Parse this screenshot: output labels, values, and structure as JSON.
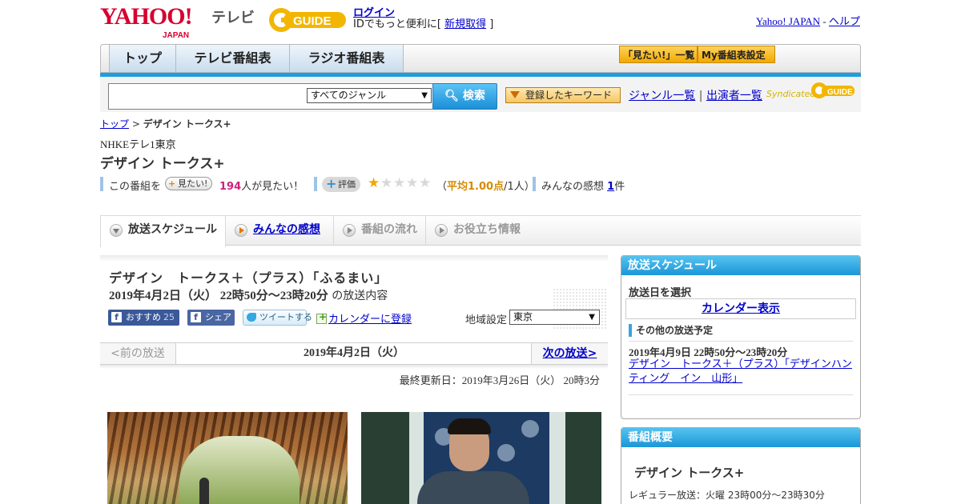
{
  "header": {
    "yahoo_logo": "YAHOO!",
    "yahoo_japan": "JAPAN",
    "tv_label": "テレビ",
    "gguide_logo": "GUIDE",
    "login_link": "ログイン",
    "login_sub_prefix": "IDでもっと便利に[",
    "signup_link": "新規取得",
    "login_sub_suffix": "]",
    "yahoo_japan_link": "Yahoo! JAPAN",
    "separator": "-",
    "help_link": "ヘルプ"
  },
  "nav": {
    "tabs": [
      {
        "label": "トップ"
      },
      {
        "label": "テレビ番組表"
      },
      {
        "label": "ラジオ番組表"
      }
    ],
    "mitai_list": "「見たい!」一覧",
    "my_schedule": "My番組表設定"
  },
  "search": {
    "input_value": "",
    "genre_selected": "すべてのジャンル",
    "search_button": "検索",
    "keyword_button": "登録したキーワード",
    "genre_list_link": "ジャンル一覧",
    "link_separator": "|",
    "performer_list_link": "出演者一覧",
    "syndicated": "Syndicated"
  },
  "breadcrumb": {
    "top": "トップ",
    "sep": ">",
    "current": "デザイン トークス+"
  },
  "program": {
    "channel": "NHKEテレ1東京",
    "title": "デザイン トークス+",
    "mitai_prefix": "この番組を",
    "mitai_button": "見たい!",
    "mitai_count": "194",
    "mitai_suffix": "人が見たい！",
    "rating_button": "評価",
    "rating_stars": 1,
    "rating_max": 5,
    "rating_open": "（",
    "rating_avg": "平均1.00点",
    "rating_people": "/1人）",
    "impressions_label": "みんなの感想",
    "impressions_count": "1",
    "impressions_suffix": "件"
  },
  "tabs": [
    {
      "label": "放送スケジュール"
    },
    {
      "label": "みんなの感想"
    },
    {
      "label": "番組の流れ"
    },
    {
      "label": "お役立ち情報"
    }
  ],
  "episode": {
    "title": "デザイン　トークス＋（プラス）「ふるまい」",
    "time": "2019年4月2日（火） 22時50分～23時20分",
    "time_suffix": "の放送内容",
    "fb_recommend": "おすすめ",
    "fb_count": "25",
    "fb_share": "シェア",
    "tweet": "ツイートする",
    "calendar_register": "カレンダーに登録",
    "region_label": "地域設定",
    "region_selected": "東京",
    "prev": "<前の放送",
    "date": "2019年4月2日（火）",
    "next": "次の放送>",
    "updated": "最終更新日：2019年3月26日（火） 20時3分"
  },
  "sidebar": {
    "schedule_head": "放送スケジュール",
    "select_date": "放送日を選択",
    "calendar_button": "カレンダー表示",
    "other_head": "その他の放送予定",
    "other_date": "2019年4月9日 22時50分～23時20分",
    "other_link": "デザイン　トークス＋（プラス）「デザインハンティング　イン　山形」",
    "summary_head": "番組概要",
    "summary_title": "デザイン トークス+",
    "summary_regular": "レギュラー放送：火曜 23時00分～23時30分"
  },
  "colors": {
    "accent_blue": "#1d9ee0",
    "link": "#0000cc",
    "pink_count": "#d0227a",
    "star": "#f0a800",
    "yahoo_red": "#d7002f"
  }
}
